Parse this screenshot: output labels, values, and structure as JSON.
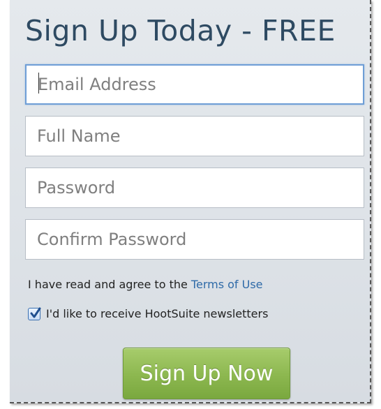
{
  "form": {
    "title": "Sign Up Today - FREE",
    "fields": {
      "email": {
        "placeholder": "Email Address",
        "value": ""
      },
      "full_name": {
        "placeholder": "Full Name",
        "value": ""
      },
      "password": {
        "placeholder": "Password",
        "value": ""
      },
      "confirm_password": {
        "placeholder": "Confirm Password",
        "value": ""
      }
    },
    "terms_text": "I have read and agree to the",
    "terms_link": "Terms of Use",
    "newsletter_label": "I'd like to receive HootSuite newsletters",
    "newsletter_checked": true,
    "submit_label": "Sign Up Now"
  },
  "colors": {
    "title": "#2e4a62",
    "link": "#2f6aa8",
    "button": "#8cb74f"
  },
  "icons": {
    "checkbox": "checkmark-icon"
  }
}
